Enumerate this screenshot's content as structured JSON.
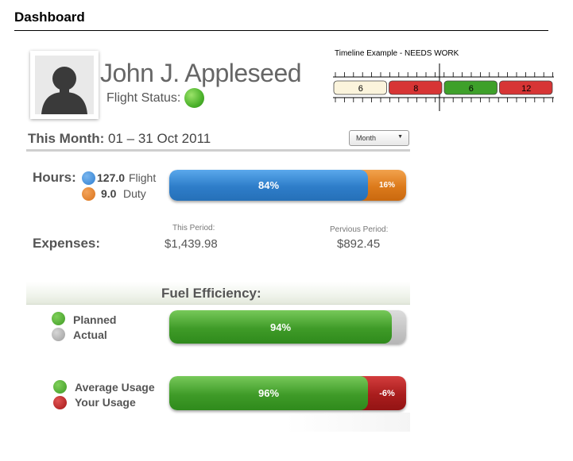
{
  "header": {
    "title": "Dashboard"
  },
  "profile": {
    "name": "John J. Appleseed",
    "flight_status_label": "Flight Status:",
    "flight_status_color": "#4cb22b"
  },
  "timeline": {
    "title": "Timeline Example - NEEDS WORK",
    "segments": [
      {
        "label": "6",
        "color": "#fbf4dc"
      },
      {
        "label": "8",
        "color": "#d73535"
      },
      {
        "label": "6",
        "color": "#3ea02a"
      },
      {
        "label": "12",
        "color": "#d73535"
      }
    ]
  },
  "month": {
    "label": "This Month:",
    "range": "01 – 31 Oct 2011",
    "period_select": {
      "selected": "Month",
      "icon": "chevron-down-icon"
    }
  },
  "hours": {
    "label": "Hours:",
    "flight_value": "127.0",
    "flight_label": "Flight",
    "duty_value": "9.0",
    "duty_label": "Duty",
    "flight_percent_label": "84%",
    "duty_percent_label": "16%",
    "flight_fraction": 0.84,
    "colors": {
      "flight": "#2f7fd1",
      "duty": "#d9731b"
    }
  },
  "expenses": {
    "label": "Expenses:",
    "this_period_label": "This Period:",
    "this_period_value": "$1,439.98",
    "previous_period_label": "Pervious Period:",
    "previous_period_value": "$892.45"
  },
  "fuel": {
    "title": "Fuel Efficiency:",
    "planned_label": "Planned",
    "actual_label": "Actual",
    "planned_percent_label": "94%",
    "planned_fraction": 0.94,
    "average_label": "Average Usage",
    "your_label": "Your Usage",
    "average_percent_label": "96%",
    "your_percent_label": "-6%",
    "average_fraction": 0.84,
    "colors": {
      "planned": "#3f9a25",
      "actual": "#9d9d9d",
      "average": "#3f9a25",
      "your": "#a51717"
    }
  }
}
